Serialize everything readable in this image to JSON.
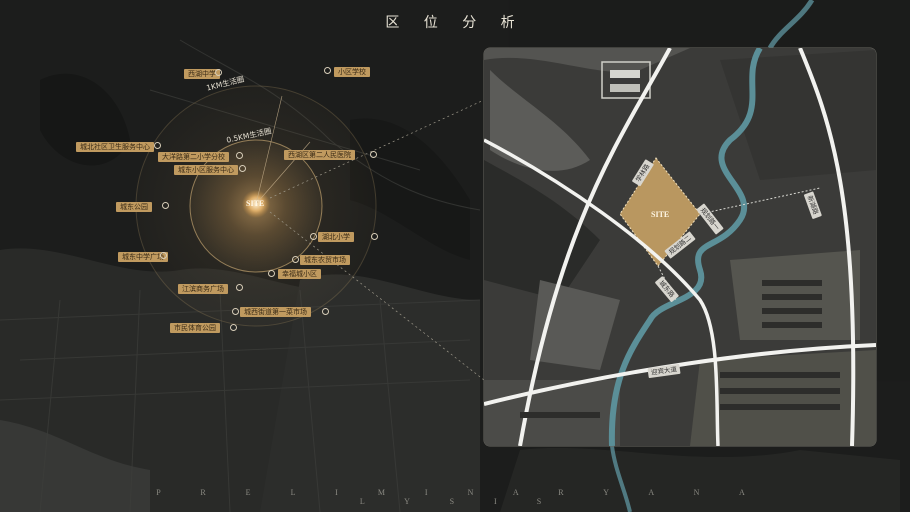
{
  "header": {
    "title": "区 位 分 析"
  },
  "footer": {
    "subtitle": "P R E L I M I N A R Y   A N A L Y S I S"
  },
  "map": {
    "ring_labels": {
      "ring_1km": "1KM生活圈",
      "ring_05km": "0.5KM生活圈"
    },
    "site_label": "SITE",
    "poi": [
      {
        "text": "西湖中学"
      },
      {
        "text": "小区学校"
      },
      {
        "text": "城北社区卫生服务中心"
      },
      {
        "text": "大洋路第二小学分校"
      },
      {
        "text": "城东小区服务中心"
      },
      {
        "text": "西湖区第二人民医院"
      },
      {
        "text": "城东公园"
      },
      {
        "text": "湖北小学"
      },
      {
        "text": "城东中学广场"
      },
      {
        "text": "城东农贸市场"
      },
      {
        "text": "幸福城小区"
      },
      {
        "text": "江滨商务广场"
      },
      {
        "text": "城西街道第一菜市场"
      },
      {
        "text": "市民体育公园"
      }
    ]
  },
  "inset": {
    "site_label": "SITE",
    "roads": [
      {
        "text": "学林路"
      },
      {
        "text": "规划路一"
      },
      {
        "text": "规划路二"
      },
      {
        "text": "城东路"
      },
      {
        "text": "新湖路"
      },
      {
        "text": "迎宾大道"
      }
    ]
  },
  "colors": {
    "background": "#1c1d1c",
    "accent_gold": "#c09a5f",
    "river": "#5b8f98",
    "road": "#f2f2ef"
  }
}
